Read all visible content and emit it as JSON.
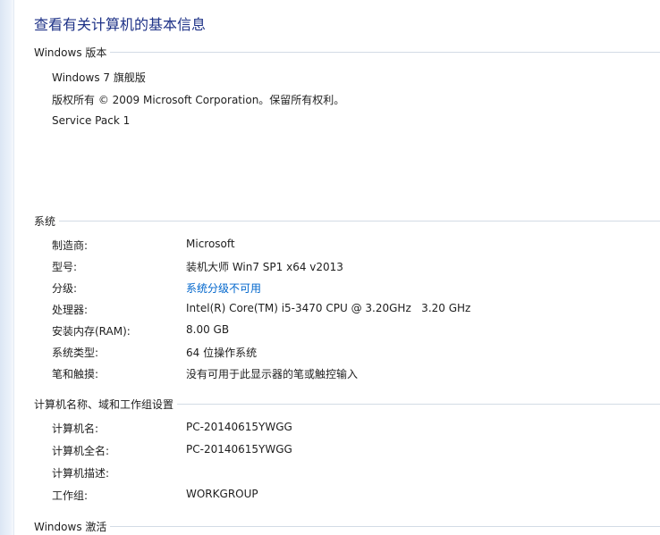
{
  "title": "查看有关计算机的基本信息",
  "edition": {
    "header": "Windows 版本",
    "lines": [
      "Windows 7 旗舰版",
      "版权所有 © 2009 Microsoft Corporation。保留所有权利。",
      "Service Pack 1"
    ]
  },
  "system": {
    "header": "系统",
    "rows": [
      {
        "label": "制造商:",
        "value": "Microsoft"
      },
      {
        "label": "型号:",
        "value": "装机大师 Win7 SP1 x64 v2013"
      },
      {
        "label": "分级:",
        "value": "系统分级不可用"
      },
      {
        "label": "处理器:",
        "value": "Intel(R) Core(TM) i5-3470 CPU @ 3.20GHz   3.20 GHz"
      },
      {
        "label": "安装内存(RAM):",
        "value": "8.00 GB"
      },
      {
        "label": "系统类型:",
        "value": "64 位操作系统"
      },
      {
        "label": "笔和触摸:",
        "value": "没有可用于此显示器的笔或触控输入"
      }
    ]
  },
  "computer": {
    "header": "计算机名称、域和工作组设置",
    "rows": [
      {
        "label": "计算机名:",
        "value": "PC-20140615YWGG"
      },
      {
        "label": "计算机全名:",
        "value": "PC-20140615YWGG"
      },
      {
        "label": "计算机描述:",
        "value": ""
      },
      {
        "label": "工作组:",
        "value": "WORKGROUP"
      }
    ]
  },
  "activation": {
    "header": "Windows 激活"
  },
  "colors": {
    "title": "#1e3287",
    "link": "#0066cc",
    "rule": "#d3dbe5"
  }
}
